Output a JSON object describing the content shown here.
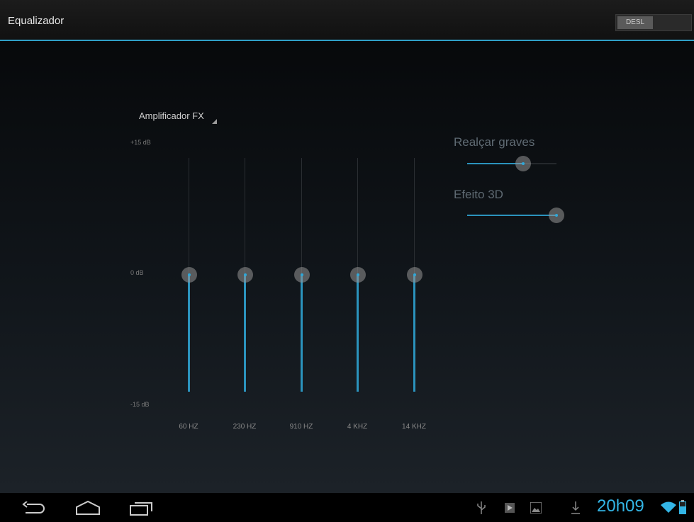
{
  "header": {
    "title": "Equalizador",
    "toggle_label": "DESL"
  },
  "equalizer": {
    "preset": "Amplificador FX",
    "db_max": "+15 dB",
    "db_mid": "0 dB",
    "db_min": "-15 dB",
    "bands": [
      {
        "label": "60 HZ",
        "gain_db": 0
      },
      {
        "label": "230 HZ",
        "gain_db": 0
      },
      {
        "label": "910 HZ",
        "gain_db": 0
      },
      {
        "label": "4 KHZ",
        "gain_db": 0
      },
      {
        "label": "14 KHZ",
        "gain_db": 0
      }
    ]
  },
  "effects": {
    "bass_label": "Realçar graves",
    "bass_level": 0.63,
    "virtualizer_label": "Efeito 3D",
    "virtualizer_level": 1.0
  },
  "navbar": {
    "icons": [
      "back-icon",
      "home-icon",
      "recent-apps-icon"
    ]
  },
  "statusbar": {
    "time": "20h09",
    "icons": [
      "usb-icon",
      "media-play-icon",
      "gallery-icon",
      "download-icon",
      "wifi-icon",
      "battery-icon"
    ]
  },
  "colors": {
    "accent": "#2b93bd",
    "clock": "#33b5e5"
  }
}
